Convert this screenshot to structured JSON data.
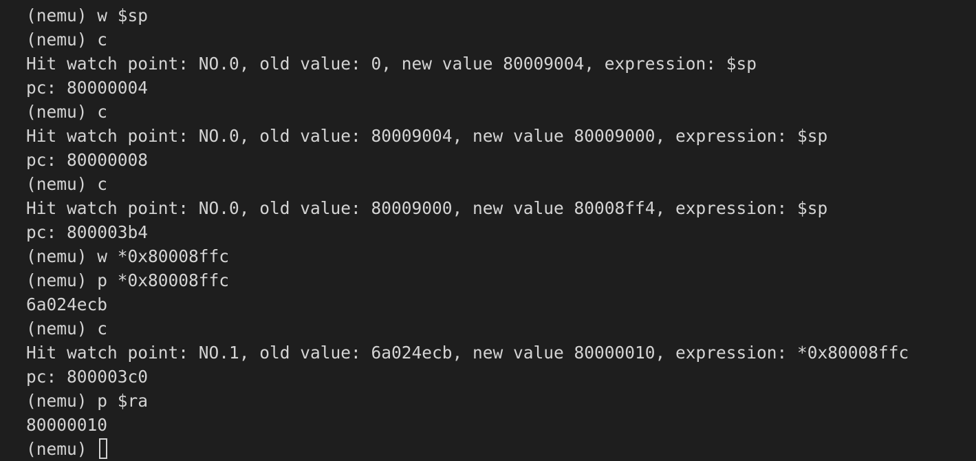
{
  "terminal": {
    "lines": [
      "(nemu) w $sp",
      "(nemu) c",
      "Hit watch point: NO.0, old value: 0, new value 80009004, expression: $sp",
      "pc: 80000004",
      "(nemu) c",
      "Hit watch point: NO.0, old value: 80009004, new value 80009000, expression: $sp",
      "pc: 80000008",
      "(nemu) c",
      "Hit watch point: NO.0, old value: 80009000, new value 80008ff4, expression: $sp",
      "pc: 800003b4",
      "(nemu) w *0x80008ffc",
      "(nemu) p *0x80008ffc",
      "6a024ecb",
      "(nemu) c",
      "Hit watch point: NO.1, old value: 6a024ecb, new value 80000010, expression: *0x80008ffc",
      "pc: 800003c0",
      "(nemu) p $ra",
      "80000010"
    ],
    "prompt": "(nemu) ",
    "colors": {
      "background": "#1e1e1e",
      "foreground": "#d4d4d4"
    }
  }
}
